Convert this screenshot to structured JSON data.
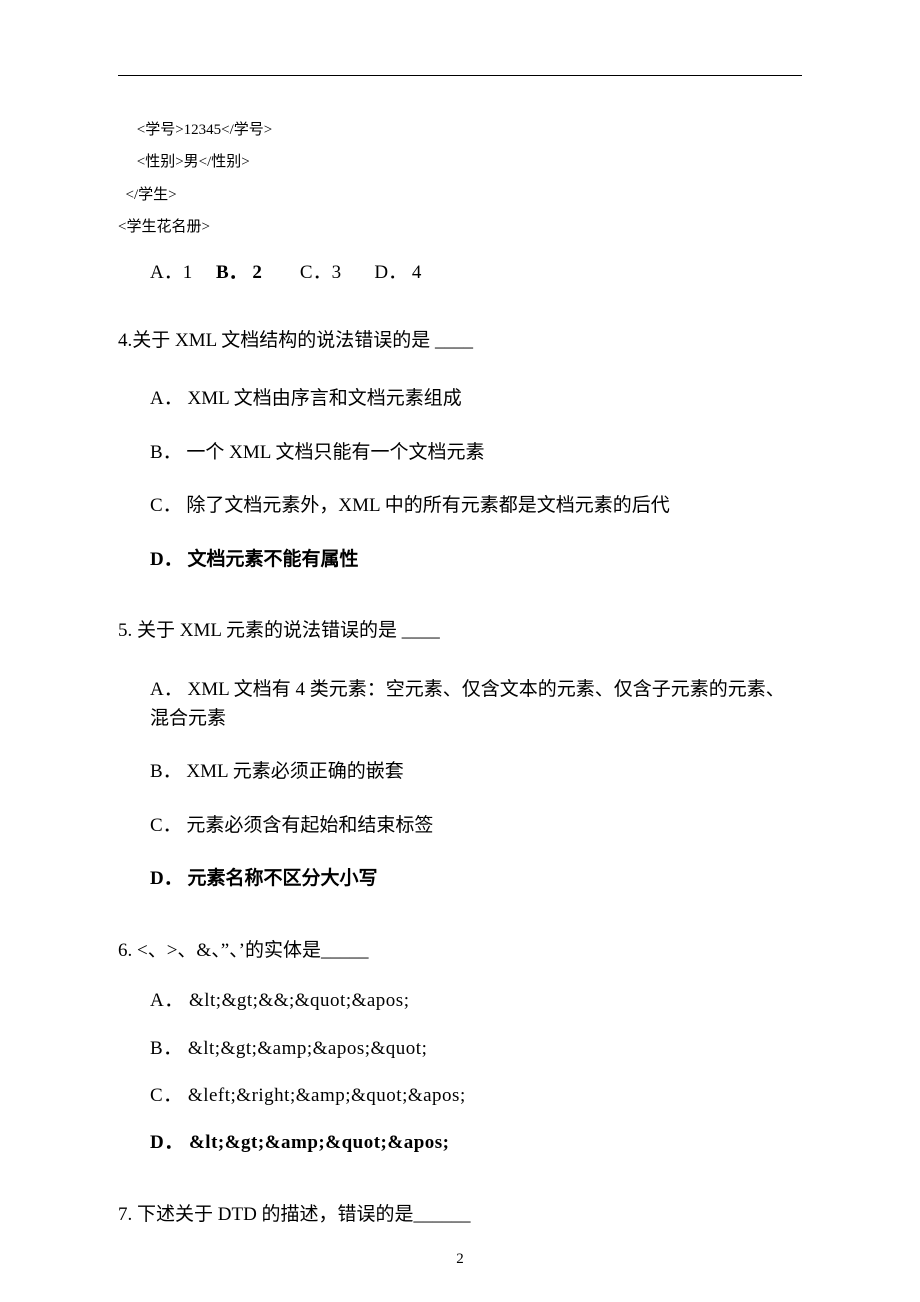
{
  "xml": {
    "l1": "     <学号>12345</学号>",
    "l2": "     <性别>男</性别>",
    "l3": "  </学生>",
    "l4": "<学生花名册>"
  },
  "q3": {
    "a": "A．1",
    "b": "B． 2",
    "c": "C．3",
    "d": "D． 4"
  },
  "q4": {
    "stem": "4.关于 XML 文档结构的说法错误的是 ____",
    "a": "A． XML 文档由序言和文档元素组成",
    "b": "B． 一个 XML 文档只能有一个文档元素",
    "c": "C． 除了文档元素外，XML 中的所有元素都是文档元素的后代",
    "d": "D． 文档元素不能有属性"
  },
  "q5": {
    "stem": "5. 关于 XML 元素的说法错误的是 ____",
    "a": "A． XML 文档有 4 类元素：空元素、仅含文本的元素、仅含子元素的元素、混合元素",
    "b": "B． XML 元素必须正确的嵌套",
    "c": "C． 元素必须含有起始和结束标签",
    "d": "D． 元素名称不区分大小写"
  },
  "q6": {
    "stem": "6. <、>、&、”、’的实体是_____",
    "a": "A． &lt;&gt;&&;&quot;&apos;",
    "b": "B． &lt;&gt;&amp;&apos;&quot;",
    "c": "C． &left;&right;&amp;&quot;&apos;",
    "d": "D． &lt;&gt;&amp;&quot;&apos;"
  },
  "q7": {
    "stem": "7. 下述关于 DTD 的描述，错误的是______"
  },
  "page_number": "2"
}
